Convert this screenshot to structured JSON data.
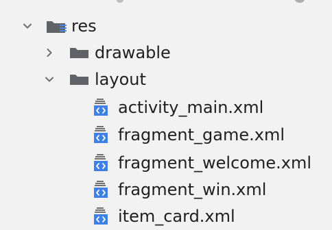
{
  "tree": {
    "res": {
      "label": "res",
      "expanded": true
    },
    "drawable": {
      "label": "drawable",
      "expanded": false
    },
    "layout": {
      "label": "layout",
      "expanded": true
    },
    "files": [
      {
        "label": "activity_main.xml"
      },
      {
        "label": "fragment_game.xml"
      },
      {
        "label": "fragment_welcome.xml"
      },
      {
        "label": "fragment_win.xml"
      },
      {
        "label": "item_card.xml"
      }
    ]
  },
  "icons": {
    "expand": "chevron-down-icon",
    "collapse": "chevron-right-icon",
    "resource_folder": "resource-folder-icon",
    "folder": "folder-icon",
    "xml_file": "xml-layout-file-icon"
  },
  "colors": {
    "background": "#f2f2f2",
    "text": "#1f1f1f",
    "chevron": "#6e6e6e",
    "folder": "#5f6368",
    "resource_lines": "#4a86e8",
    "xml_blue": "#3f7fe6",
    "xml_gray": "#707070"
  }
}
